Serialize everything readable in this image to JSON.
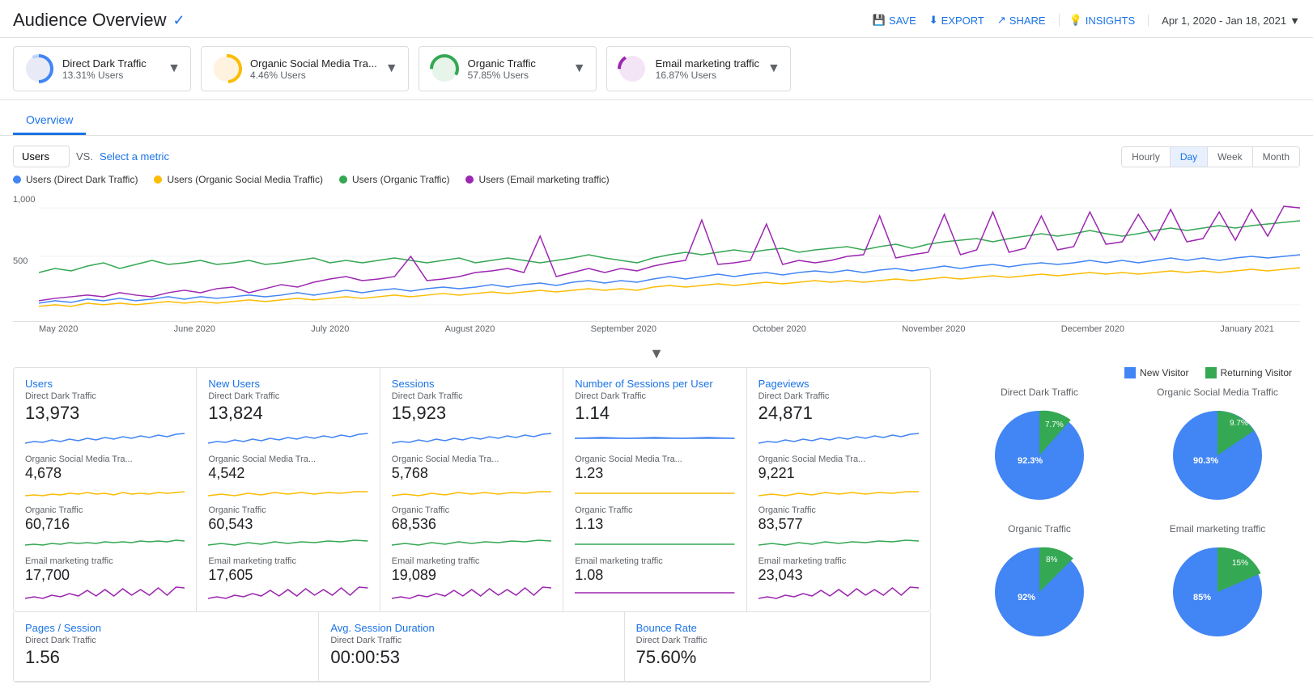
{
  "header": {
    "title": "Audience Overview",
    "verified": "✓",
    "actions": {
      "save": "SAVE",
      "export": "EXPORT",
      "share": "SHARE",
      "insights": "INSIGHTS"
    },
    "date_range": "Apr 1, 2020 - Jan 18, 2021"
  },
  "segments": [
    {
      "name": "Direct Dark Traffic",
      "pct": "13.31% Users",
      "color_fill": "#4285f4",
      "color_empty": "#e8eaf6",
      "pct_val": 13.31
    },
    {
      "name": "Organic Social Media Tra...",
      "pct": "4.46% Users",
      "color_fill": "#fbbc04",
      "color_empty": "#fff3e0",
      "pct_val": 4.46
    },
    {
      "name": "Organic Traffic",
      "pct": "57.85% Users",
      "color_fill": "#34a853",
      "color_empty": "#e6f4ea",
      "pct_val": 57.85
    },
    {
      "name": "Email marketing traffic",
      "pct": "16.87% Users",
      "color_fill": "#9c27b0",
      "color_empty": "#f3e5f5",
      "pct_val": 16.87
    }
  ],
  "tabs": {
    "active": "Overview",
    "items": [
      "Overview"
    ]
  },
  "chart_controls": {
    "metric": "Users",
    "vs_label": "VS.",
    "select_metric": "Select a metric",
    "time_buttons": [
      "Hourly",
      "Day",
      "Week",
      "Month"
    ],
    "active_time": "Day"
  },
  "legend": [
    {
      "label": "Users (Direct Dark Traffic)",
      "color": "#4285f4"
    },
    {
      "label": "Users (Organic Social Media Traffic)",
      "color": "#fbbc04"
    },
    {
      "label": "Users (Organic Traffic)",
      "color": "#34a853"
    },
    {
      "label": "Users (Email marketing traffic)",
      "color": "#9c27b0"
    }
  ],
  "chart": {
    "y_labels": [
      "1,000",
      "500"
    ],
    "x_labels": [
      "May 2020",
      "June 2020",
      "July 2020",
      "August 2020",
      "September 2020",
      "October 2020",
      "November 2020",
      "December 2020",
      "January 2021"
    ]
  },
  "metrics": [
    {
      "title": "Users",
      "rows": [
        {
          "segment": "Direct Dark Traffic",
          "value": "13,973",
          "color": "#4285f4"
        },
        {
          "segment": "Organic Social Media Tra...",
          "value": "4,678",
          "color": "#fbbc04"
        },
        {
          "segment": "Organic Traffic",
          "value": "60,716",
          "color": "#34a853"
        },
        {
          "segment": "Email marketing traffic",
          "value": "17,700",
          "color": "#9c27b0"
        }
      ]
    },
    {
      "title": "New Users",
      "rows": [
        {
          "segment": "Direct Dark Traffic",
          "value": "13,824",
          "color": "#4285f4"
        },
        {
          "segment": "Organic Social Media Tra...",
          "value": "4,542",
          "color": "#fbbc04"
        },
        {
          "segment": "Organic Traffic",
          "value": "60,543",
          "color": "#34a853"
        },
        {
          "segment": "Email marketing traffic",
          "value": "17,605",
          "color": "#9c27b0"
        }
      ]
    },
    {
      "title": "Sessions",
      "rows": [
        {
          "segment": "Direct Dark Traffic",
          "value": "15,923",
          "color": "#4285f4"
        },
        {
          "segment": "Organic Social Media Tra...",
          "value": "5,768",
          "color": "#fbbc04"
        },
        {
          "segment": "Organic Traffic",
          "value": "68,536",
          "color": "#34a853"
        },
        {
          "segment": "Email marketing traffic",
          "value": "19,089",
          "color": "#9c27b0"
        }
      ]
    },
    {
      "title": "Number of Sessions per User",
      "rows": [
        {
          "segment": "Direct Dark Traffic",
          "value": "1.14",
          "color": "#4285f4"
        },
        {
          "segment": "Organic Social Media Tra...",
          "value": "1.23",
          "color": "#fbbc04"
        },
        {
          "segment": "Organic Traffic",
          "value": "1.13",
          "color": "#34a853"
        },
        {
          "segment": "Email marketing traffic",
          "value": "1.08",
          "color": "#9c27b0"
        }
      ]
    },
    {
      "title": "Pageviews",
      "rows": [
        {
          "segment": "Direct Dark Traffic",
          "value": "24,871",
          "color": "#4285f4"
        },
        {
          "segment": "Organic Social Media Tra...",
          "value": "9,221",
          "color": "#fbbc04"
        },
        {
          "segment": "Organic Traffic",
          "value": "83,577",
          "color": "#34a853"
        },
        {
          "segment": "Email marketing traffic",
          "value": "23,043",
          "color": "#9c27b0"
        }
      ]
    }
  ],
  "bottom_metrics": [
    {
      "title": "Pages / Session",
      "rows": [
        {
          "segment": "Direct Dark Traffic",
          "value": "1.56",
          "color": "#4285f4"
        }
      ]
    },
    {
      "title": "Avg. Session Duration",
      "rows": [
        {
          "segment": "Direct Dark Traffic",
          "value": "00:00:53",
          "color": "#4285f4"
        }
      ]
    },
    {
      "title": "Bounce Rate",
      "rows": [
        {
          "segment": "Direct Dark Traffic",
          "value": "75.60%",
          "color": "#4285f4"
        }
      ]
    }
  ],
  "pie_charts": {
    "legend": [
      {
        "label": "New Visitor",
        "color": "#4285f4"
      },
      {
        "label": "Returning Visitor",
        "color": "#34a853"
      }
    ],
    "charts": [
      {
        "title": "Direct Dark Traffic",
        "new_visitor_pct": 92.3,
        "returning_pct": 7.7,
        "new_label": "92.3%",
        "ret_label": "7.7%"
      },
      {
        "title": "Organic Social Media Traffic",
        "new_visitor_pct": 90.3,
        "returning_pct": 9.7,
        "new_label": "90.3%",
        "ret_label": "9.7%"
      },
      {
        "title": "Organic Traffic",
        "new_visitor_pct": 92.0,
        "returning_pct": 8.0,
        "new_label": "92%",
        "ret_label": "8%"
      },
      {
        "title": "Email marketing traffic",
        "new_visitor_pct": 85.0,
        "returning_pct": 15.0,
        "new_label": "85%",
        "ret_label": "15%"
      }
    ]
  }
}
